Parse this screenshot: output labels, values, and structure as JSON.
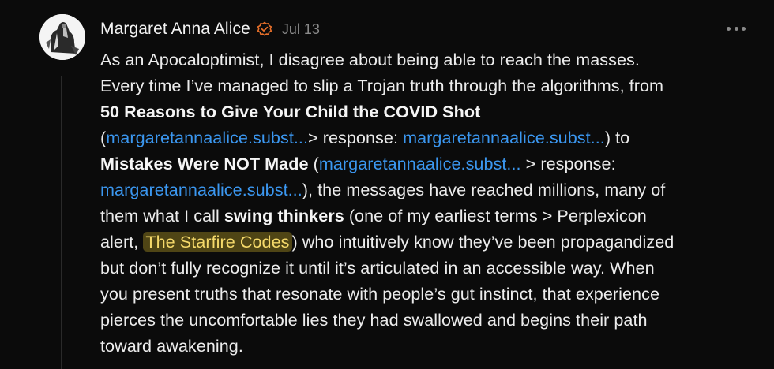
{
  "comment": {
    "author": "Margaret Anna Alice",
    "date": "Jul 13",
    "icons": {
      "verified": "verified-badge-icon",
      "more": "more-options-icon",
      "avatar": "avatar-illustration"
    },
    "colors": {
      "link": "#3b97f0",
      "highlight_bg": "#4f4515",
      "highlight_text": "#f5d96a",
      "verified": "#e8702a"
    },
    "lines": {
      "l1": "As an Apocaloptimist, I disagree about being able to reach the masses.",
      "l2": "Every time I’ve managed to slip a Trojan truth through the algorithms, from",
      "l3_bold": "50 Reasons to Give Your Child the COVID Shot",
      "l4_open": "(",
      "l4_link1": "margaretannaalice.subst...",
      "l4_mid": "> response: ",
      "l4_link2": "margaretannaalice.subst...",
      "l4_end": ") to",
      "l5_bold": "Mistakes Were NOT Made",
      "l5_open": " (",
      "l5_link": "margaretannaalice.subst...",
      "l5_end": " > response:",
      "l6_link": "margaretannaalice.subst...",
      "l6_end": "), the messages have reached millions, many of",
      "l7_start": "them what I call ",
      "l7_bold": "swing thinkers",
      "l7_end": " (one of my earliest terms > Perplexicon",
      "l8_start": "alert, ",
      "l8_highlight": "The Starfire Codes",
      "l8_end": ") who intuitively know they’ve been propagandized",
      "l9": "but don’t fully recognize it until it’s articulated in an accessible way. When",
      "l10": "you present truths that resonate with people’s gut instinct, that experience",
      "l11": "pierces the uncomfortable lies they had swallowed and begins their path",
      "l12": "toward awakening."
    }
  }
}
